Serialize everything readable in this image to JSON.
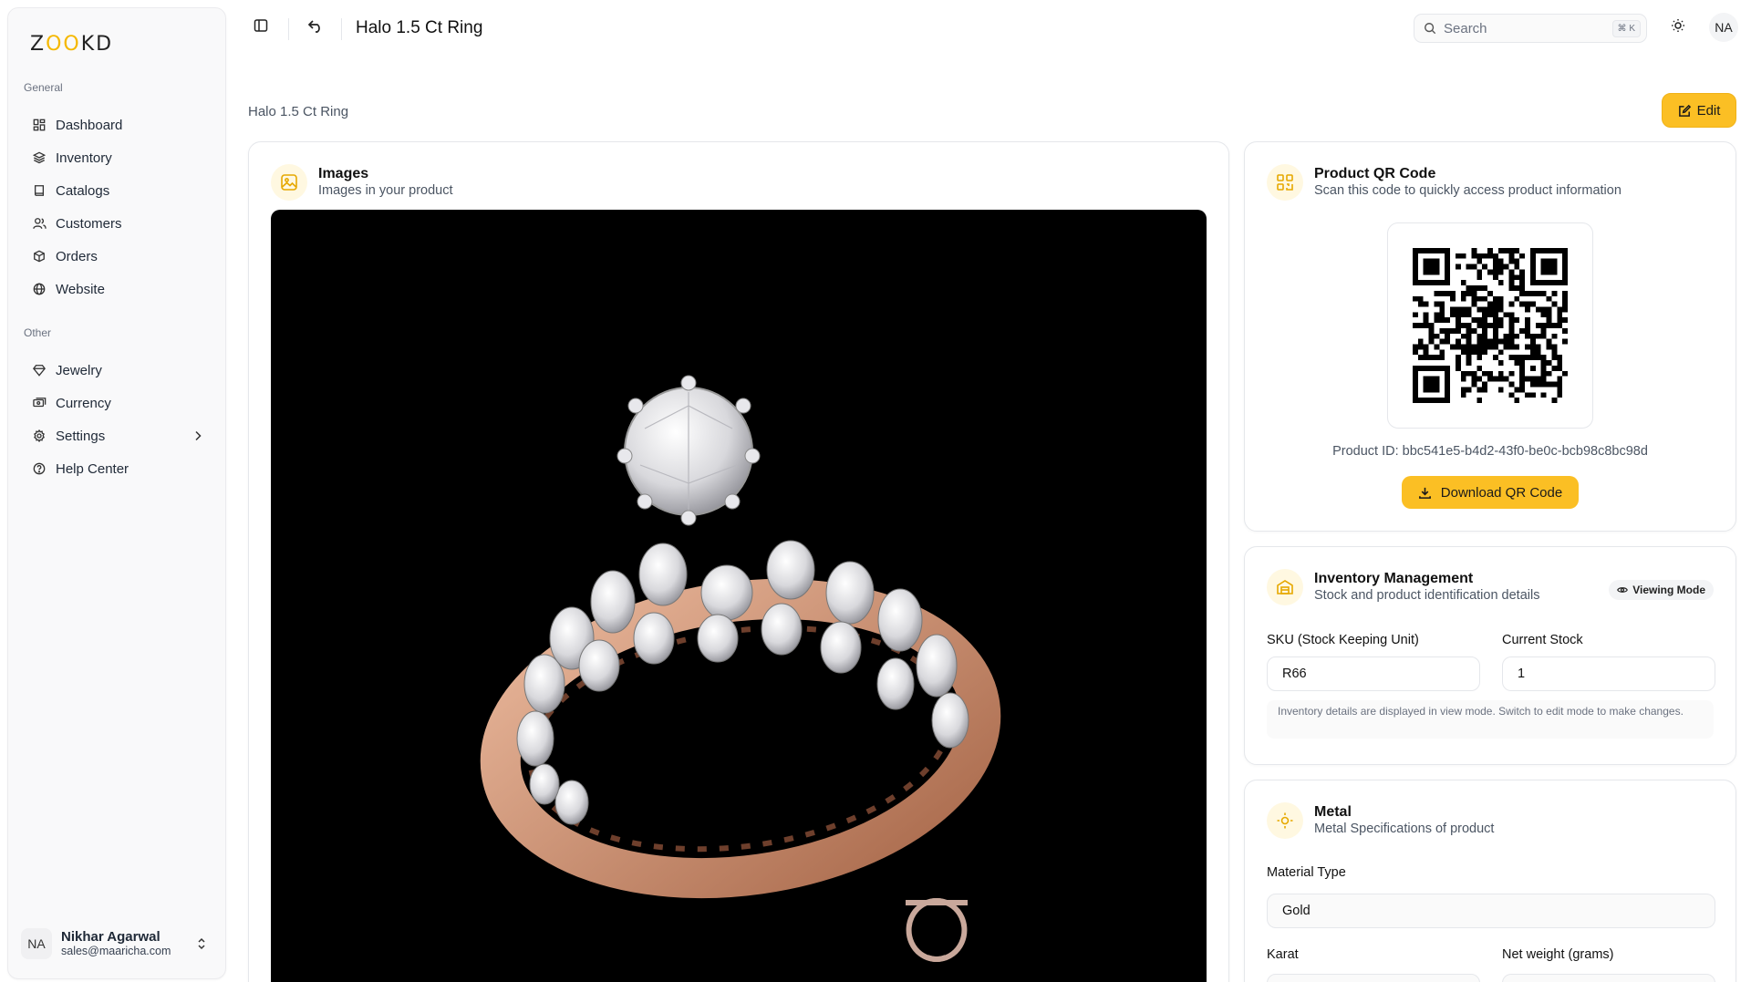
{
  "brand": {
    "logo_left": "Z",
    "logo_oo": "OO",
    "logo_right": "KD"
  },
  "sidebar": {
    "general_title": "General",
    "general_items": [
      {
        "label": "Dashboard",
        "icon": "dashboard-icon"
      },
      {
        "label": "Inventory",
        "icon": "layers-icon"
      },
      {
        "label": "Catalogs",
        "icon": "book-icon"
      },
      {
        "label": "Customers",
        "icon": "users-icon"
      },
      {
        "label": "Orders",
        "icon": "package-icon"
      },
      {
        "label": "Website",
        "icon": "globe-icon"
      }
    ],
    "other_title": "Other",
    "other_items": [
      {
        "label": "Jewelry",
        "icon": "gem-icon"
      },
      {
        "label": "Currency",
        "icon": "currency-icon"
      },
      {
        "label": "Settings",
        "icon": "gear-icon"
      },
      {
        "label": "Help Center",
        "icon": "help-icon"
      }
    ],
    "user": {
      "initials": "NA",
      "name": "Nikhar Agarwal",
      "email": "sales@maaricha.com"
    }
  },
  "header": {
    "title": "Halo 1.5 Ct Ring",
    "search_placeholder": "Search",
    "search_shortcut": "⌘ K",
    "avatar_initials": "NA"
  },
  "breadcrumb": "Halo 1.5 Ct Ring",
  "edit_label": "Edit",
  "images_card": {
    "title": "Images",
    "subtitle": "Images in your product"
  },
  "qr_card": {
    "title": "Product QR Code",
    "subtitle": "Scan this code to quickly access product information",
    "product_id": "Product ID: bbc541e5-b4d2-43f0-be0c-bcb98c8bc98d",
    "download_label": "Download QR Code"
  },
  "inventory_card": {
    "title": "Inventory Management",
    "subtitle": "Stock and product identification details",
    "mode_label": "Viewing Mode",
    "sku_label": "SKU (Stock Keeping Unit)",
    "sku_value": "R66",
    "stock_label": "Current Stock",
    "stock_value": "1",
    "note": "Inventory details are displayed in view mode. Switch to edit mode to make changes."
  },
  "metal_card": {
    "title": "Metal",
    "subtitle": "Metal Specifications of product",
    "material_label": "Material Type",
    "material_value": "Gold",
    "karat_label": "Karat",
    "weight_label": "Net weight (grams)"
  },
  "colors": {
    "accent": "#fbbf24",
    "accent_soft": "#fff8e1",
    "image_bg": "#000000"
  }
}
